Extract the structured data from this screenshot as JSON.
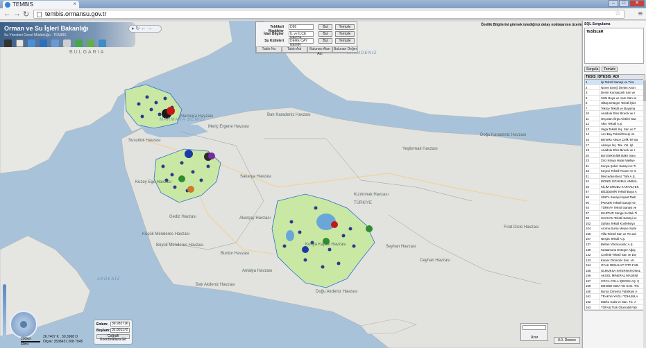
{
  "browser": {
    "tab_title": "TEMBIS",
    "url": "tembis.ormansu.gov.tr"
  },
  "header": {
    "title": "Orman ve Su İşleri Bakanlığı",
    "subtitle": "Su Yönetimi Genel Müdürlüğü - TEMBİS"
  },
  "query": {
    "rows": [
      {
        "label": "Tehlikeli Maddeler",
        "value": "D88",
        "search": "Bul",
        "clear": "Temizle"
      },
      {
        "label": "İdari Bilgiler",
        "value": "İL ve İLÇE HAVZA",
        "search": "Bul",
        "clear": "Temizle"
      },
      {
        "label": "Su Kütleleri",
        "value": "DERE ÇAY NEHİR",
        "search": "Bul",
        "clear": "Temizle"
      }
    ],
    "tabs": [
      "Tablo No",
      "Tablo Adı",
      "Bulunan Alan Adı",
      "Bulunan Değer"
    ]
  },
  "notice": "Özellik Bilgilerini görmek istediğiniz detay noktalarının üzerine tıklayınız.",
  "map_labels": {
    "bulgaria": "BULGARIA",
    "black_sea": "KARADENİZ",
    "marmara_sea": "MARMARA DENİZİ",
    "aegean": "AKDENİZ",
    "turkey": "TÜRKİYE",
    "basins": [
      "Marmara Havzası",
      "Meriç Ergene Havzası",
      "Susurluk Havzası",
      "Sakarya Havzası",
      "Batı Karadeniz Havzası",
      "Yeşilırmak Havzası",
      "Doğu Karadeniz Havzası",
      "Kızılırmak Havzası",
      "Gediz Havzası",
      "Küçük Menderes Havzası",
      "Büyük Menderes Havzası",
      "Burdur Havzası",
      "Akarçay Havzası",
      "Konya Kapalı Havzası",
      "Seyhan Havzası",
      "Ceyhan Havzası",
      "Fırat Dicle Havzası",
      "Batı Akdeniz Havzası",
      "Antalya Havzası",
      "Doğu Akdeniz Havzası",
      "Kuzey Ege Havzası"
    ]
  },
  "coordinates": {
    "enlem_label": "Enlem:",
    "enlem_value": "39.932716",
    "boylam_label": "Boylam:",
    "boylam_value": "32.801172",
    "button": "Coğrafi Koordinatlara Git",
    "cursor_text_1": "26.7407 K , 30.3968 D",
    "cursor_text_2": "Ölçek: 3538437.208 7945",
    "scale_1": "200km",
    "scale_2": "40mi"
  },
  "layer_select": {
    "label": "Uzar"
  },
  "degree_button": "0.0. Derece",
  "sidebar": {
    "sql_title": "SQL Sorgulama",
    "sql_text": "TESİSLER",
    "btn_query": "Sorgula",
    "btn_clear": "Temizle",
    "col_id": "TESIS_ID",
    "col_name": "TESİS_ADI",
    "rows": [
      [
        "1",
        "İşi Tekstil Sanayi ve Tica"
      ],
      [
        "2",
        "Noren Enerji Üretim Anon"
      ],
      [
        "3",
        "Demir Kumaşçılık San ve"
      ],
      [
        "5",
        "SUN Boya ve Apre San ve"
      ],
      [
        "6",
        "Ulltaş Entegre Tekstil İşlet"
      ],
      [
        "7",
        "Tektoy Tekstil ve Boyama"
      ],
      [
        "10",
        "Anadolu Efes Birecik ve I"
      ],
      [
        "11",
        "Orçusan Örgü Aletleri San"
      ],
      [
        "12",
        "Akın Tekstil A.Ş."
      ],
      [
        "13",
        "Vega Tekstil İnş. San ve T"
      ],
      [
        "14",
        "Anıl Bey Tekstil Enerji Ve"
      ],
      [
        "16",
        "Birmeks Aksoy Çelik Tel Sa"
      ],
      [
        "17",
        "Akasya İnş. Tek. Yat. İşl."
      ],
      [
        "19",
        "Anadolu Efes Birecik ve I"
      ],
      [
        "20",
        "Bor Elektrolitik Bakır Sanı"
      ],
      [
        "23",
        "Zirci Kimya Hatai Nakliye"
      ],
      [
        "31",
        "Konya Şeker Sanayi ve Ti"
      ],
      [
        "33",
        "Keçeci Tekstil Ticaret ve S"
      ],
      [
        "41",
        "Mercedes-Benz Türk A.Ş."
      ],
      [
        "52",
        "MONDİ İSTANBUL AMBAL"
      ],
      [
        "55",
        "KİLİM GRUBU KARTALTEK"
      ],
      [
        "87",
        "BÖZDEMİR Tekstil Boya A"
      ],
      [
        "88",
        "SİNTA Sanayi İnşaat Taah"
      ],
      [
        "90",
        "İPEKER Tekstil Sanayi ve"
      ],
      [
        "93",
        "TÜRKAY Tekstil Sanayi ve"
      ],
      [
        "97",
        "MARTUR Sünger Koltuk Ti"
      ],
      [
        "98",
        "SAVCAN Tekstil Sanayi ve"
      ],
      [
        "102",
        "Safran Tekstil Konfeksiyo"
      ],
      [
        "104",
        "Aroma Bursa Meyve Sular"
      ],
      [
        "105",
        "Villa Tekstil San ve Tic.Ltd"
      ],
      [
        "107",
        "Nergis Tekstil A.Ş."
      ],
      [
        "137",
        "Beltan Vibracoustic A.Ş."
      ],
      [
        "139",
        "Kastamonu Entegre Ağaç"
      ],
      [
        "142",
        "Confetti Tekstil San ve Dış"
      ],
      [
        "143",
        "Kaiser Otomotiv San. Ve"
      ],
      [
        "154",
        "OYAK RENAULT OTO FAB."
      ],
      [
        "155",
        "OLMUKSA INTERNATIONAL"
      ],
      [
        "156",
        "AKSOL MİNERAL MADENİ"
      ],
      [
        "157",
        "COCA COLA İÇECEK AŞ. Ç"
      ],
      [
        "159",
        "MENNO GIDA VE SAN. TİC"
      ],
      [
        "160",
        "Bursa Çimento Fabrikası A"
      ],
      [
        "161",
        "TRAKYA YAĞLI TOHUMLA"
      ],
      [
        "162",
        "Marko Gıda ve San. Tic. A"
      ],
      [
        "163",
        "TOFAŞ Türk Otomobil Fab"
      ]
    ]
  }
}
